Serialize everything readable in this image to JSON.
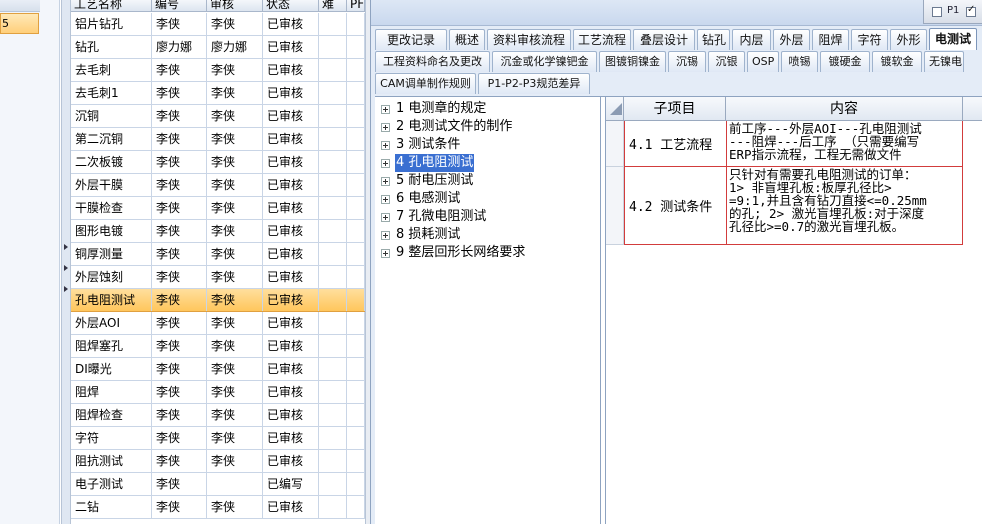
{
  "left_strip": {
    "selected_value": "5"
  },
  "process_grid": {
    "columns": [
      "工艺名称",
      "编号",
      "审核",
      "状态",
      "难",
      "PF"
    ],
    "rows": [
      [
        "铝片钻孔",
        "李侠",
        "李侠",
        "已审核"
      ],
      [
        "钻孔",
        "廖力娜",
        "廖力娜",
        "已审核"
      ],
      [
        "去毛刺",
        "李侠",
        "李侠",
        "已审核"
      ],
      [
        "去毛刺1",
        "李侠",
        "李侠",
        "已审核"
      ],
      [
        "沉铜",
        "李侠",
        "李侠",
        "已审核"
      ],
      [
        "第二沉铜",
        "李侠",
        "李侠",
        "已审核"
      ],
      [
        "二次板镀",
        "李侠",
        "李侠",
        "已审核"
      ],
      [
        "外层干膜",
        "李侠",
        "李侠",
        "已审核"
      ],
      [
        "干膜检查",
        "李侠",
        "李侠",
        "已审核"
      ],
      [
        "图形电镀",
        "李侠",
        "李侠",
        "已审核"
      ],
      [
        "铜厚测量",
        "李侠",
        "李侠",
        "已审核"
      ],
      [
        "外层蚀刻",
        "李侠",
        "李侠",
        "已审核"
      ],
      [
        "孔电阻测试",
        "李侠",
        "李侠",
        "已审核"
      ],
      [
        "外层AOI",
        "李侠",
        "李侠",
        "已审核"
      ],
      [
        "阻焊塞孔",
        "李侠",
        "李侠",
        "已审核"
      ],
      [
        "DI曝光",
        "李侠",
        "李侠",
        "已审核"
      ],
      [
        "阻焊",
        "李侠",
        "李侠",
        "已审核"
      ],
      [
        "阻焊检查",
        "李侠",
        "李侠",
        "已审核"
      ],
      [
        "字符",
        "李侠",
        "李侠",
        "已审核"
      ],
      [
        "阻抗测试",
        "李侠",
        "李侠",
        "已审核"
      ],
      [
        "电子测试",
        "李侠",
        "",
        "已编写"
      ],
      [
        "二钻",
        "李侠",
        "李侠",
        "已审核"
      ]
    ],
    "selected_index": 12
  },
  "window": {
    "chrome_label": "P1",
    "tabs_row1": [
      "更改记录",
      "概述",
      "资料审核流程",
      "工艺流程",
      "叠层设计",
      "钻孔",
      "内层",
      "外层",
      "阻焊",
      "字符",
      "外形",
      "电测试"
    ],
    "tabs_row2": [
      "工程资料命名及更改",
      "沉金或化学镍钯金",
      "图镀铜镍金",
      "沉锡",
      "沉银",
      "OSP",
      "喷锡",
      "镀硬金",
      "镀软金",
      "无镍电"
    ],
    "tabs_row3": [
      "CAM调单制作规则",
      "P1-P2-P3规范差异"
    ],
    "active_tab": "电测试"
  },
  "tree": {
    "items": [
      "1 电测章的规定",
      "2 电测试文件的制作",
      "3 测试条件",
      "4 孔电阻测试",
      "5 耐电压测试",
      "6 电感测试",
      "7 孔微电阻测试",
      "8 损耗测试",
      "9 整层回形长网络要求"
    ],
    "selected_index": 3
  },
  "detail": {
    "headers": [
      "子项目",
      "内容"
    ],
    "rows": [
      {
        "sub": "4.1 工艺流程",
        "content": "前工序---外层AOI---孔电阻测试\n---阻焊---后工序 （只需要编写\nERP指示流程，工程无需做文件"
      },
      {
        "sub": "4.2 测试条件",
        "content": "只针对有需要孔电阻测试的订单：\n1> 非盲埋孔板:板厚孔径比>\n=9:1,并且含有钻刀直接<=0.25mm\n的孔; 2> 激光盲埋孔板:对于深度\n孔径比>=0.7的激光盲埋孔板。"
      }
    ]
  }
}
